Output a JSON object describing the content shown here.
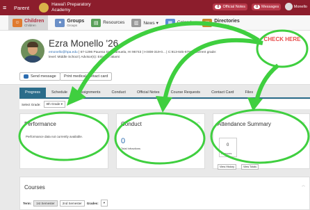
{
  "topbar": {
    "menu_icon": "≡",
    "parent_label": "Parent",
    "school_name": "Hawai'i Preparatory Academy",
    "official_notes_count": "0",
    "official_notes_label": "Official Notes",
    "messages_count": "0",
    "messages_label": "Messages",
    "user_label": "Monello"
  },
  "nav": [
    {
      "label": "Children",
      "sub": "Children",
      "icon": "children-icon",
      "color": "#e07b2f"
    },
    {
      "label": "Groups",
      "sub": "Groups",
      "icon": "groups-icon",
      "color": "#6a8fc7"
    },
    {
      "label": "Resources",
      "sub": "",
      "icon": "resources-icon",
      "color": "#5aa05a"
    },
    {
      "label": "News",
      "sub": "",
      "icon": "news-icon",
      "color": "#999999"
    },
    {
      "label": "Calendar",
      "sub": "",
      "icon": "calendar-icon",
      "color": "#5b8bd6"
    },
    {
      "label": "Directories",
      "sub": "Directories",
      "icon": "directories-icon",
      "color": "#c98b2a"
    }
  ],
  "profile": {
    "name": "Ezra Monello '26",
    "email": "emonello@hpa.edu",
    "contact_rest": " | 67-1296 Pauena St... Kamuela, HI 96743 | H:808-319-0... | C:913-645-6792 | Current grade:",
    "level": "level: Middle School | Advisor(s): Erin N... akami",
    "send_message": "Send message",
    "print_medical": "Print medical contact card"
  },
  "tabs": [
    "Progress",
    "Schedule",
    "Assignments",
    "Conduct",
    "Official Notes",
    "Course Requests",
    "Contact Card",
    "Files"
  ],
  "grade_select": {
    "label": "Select Grade:",
    "value": "8th Grade"
  },
  "performance": {
    "title": "Performance",
    "message": "Performance data not currently available."
  },
  "conduct": {
    "title": "Conduct",
    "count": "0",
    "label": "Total Infractions"
  },
  "attendance": {
    "title": "Attendance Summary",
    "count": "0",
    "label": "Absences",
    "view_history": "View History",
    "view_totals": "View Totals"
  },
  "courses": {
    "title": "Courses",
    "term_label": "Term:",
    "term1": "1st Semester",
    "term2": "2nd Semester",
    "grades_label": "Grades:"
  },
  "annotation": {
    "text": "CHECK HERE",
    "color": "#3fcf3f",
    "text_color": "#e84a4a"
  }
}
